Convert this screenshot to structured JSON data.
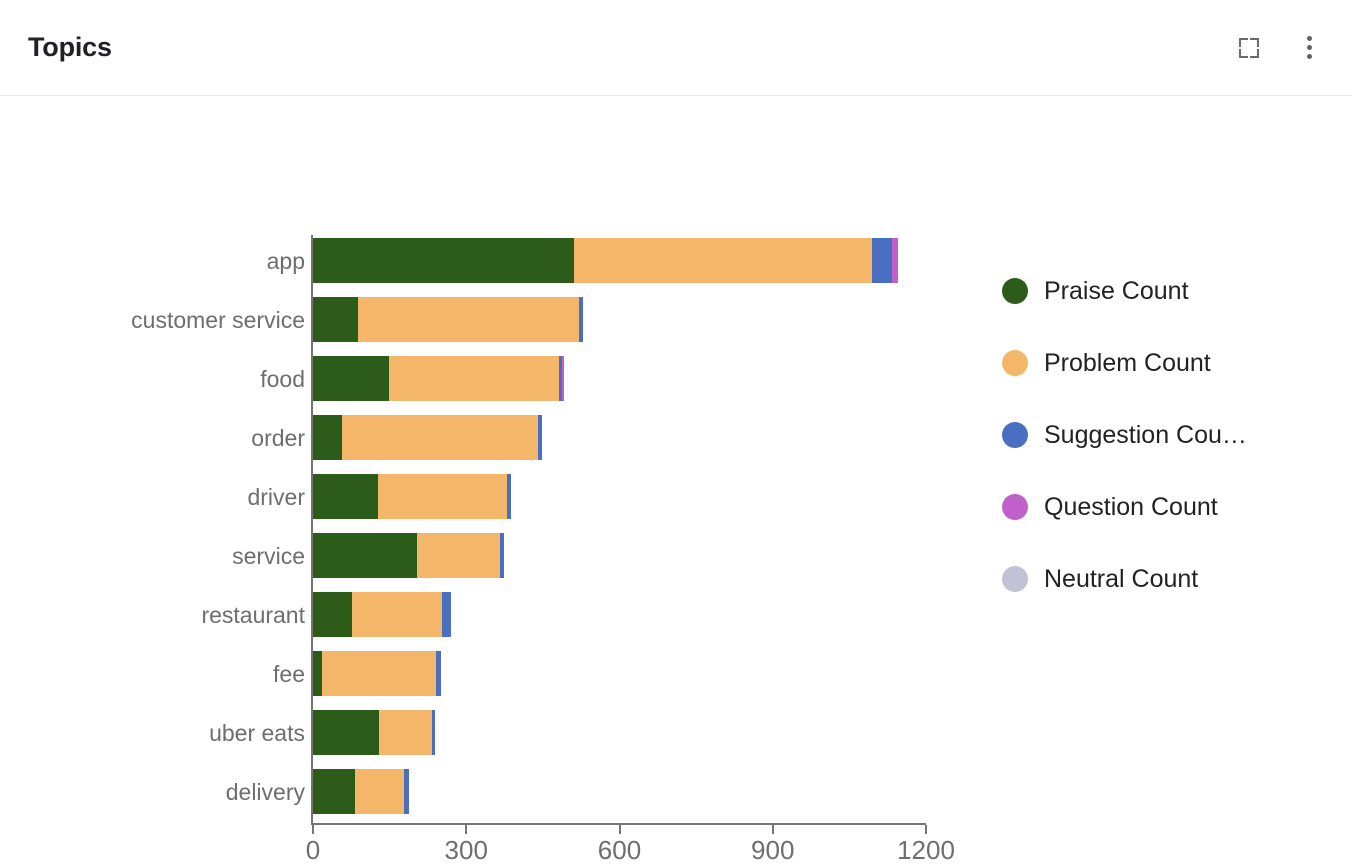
{
  "header": {
    "title": "Topics",
    "fullscreen_icon": "fullscreen-icon",
    "more_icon": "more-vertical-icon"
  },
  "legend": {
    "position": "right",
    "items": [
      {
        "label": "Praise Count",
        "color": "#2d5c1a"
      },
      {
        "label": "Problem Count",
        "color": "#f4b76a"
      },
      {
        "label": "Suggestion Cou…",
        "color": "#4a6fc0"
      },
      {
        "label": "Question Count",
        "color": "#bf61c9"
      },
      {
        "label": "Neutral Count",
        "color": "#c3c1d6"
      }
    ]
  },
  "chart_data": {
    "type": "bar",
    "orientation": "horizontal",
    "stacked": true,
    "title": "Topics",
    "xlabel": "",
    "ylabel": "",
    "xlim": [
      0,
      1200
    ],
    "xticks": [
      0,
      300,
      600,
      900,
      1200
    ],
    "grid": false,
    "categories": [
      "app",
      "customer service",
      "food",
      "order",
      "driver",
      "service",
      "restaurant",
      "fee",
      "uber eats",
      "delivery"
    ],
    "series": [
      {
        "name": "Praise Count",
        "color": "#2d5c1a",
        "values": [
          511,
          88,
          149,
          57,
          127,
          204,
          76,
          18,
          129,
          82
        ]
      },
      {
        "name": "Problem Count",
        "color": "#f4b76a",
        "values": [
          583,
          432,
          332,
          384,
          252,
          163,
          177,
          223,
          104,
          96
        ]
      },
      {
        "name": "Suggestion Count",
        "color": "#4a6fc0",
        "values": [
          39,
          8,
          6,
          8,
          9,
          6,
          17,
          10,
          6,
          10
        ]
      },
      {
        "name": "Question Count",
        "color": "#bf61c9",
        "values": [
          12,
          0,
          4,
          0,
          0,
          0,
          0,
          0,
          0,
          0
        ]
      },
      {
        "name": "Neutral Count",
        "color": "#c3c1d6",
        "values": [
          0,
          0,
          0,
          0,
          0,
          0,
          0,
          0,
          0,
          0
        ]
      }
    ],
    "totals": [
      1145,
      528,
      491,
      449,
      388,
      373,
      270,
      251,
      239,
      188
    ]
  }
}
